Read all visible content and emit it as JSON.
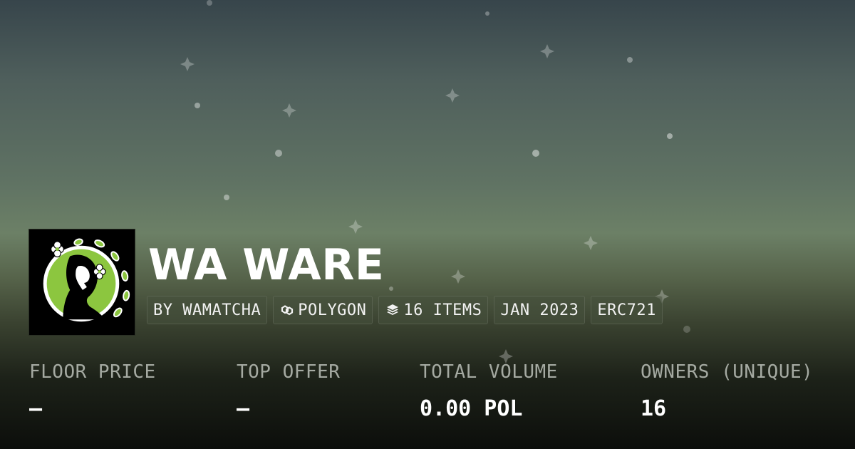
{
  "collection": {
    "name": "WA WARE",
    "creator": "BY WAMATCHA",
    "chain": "POLYGON",
    "items": "16 ITEMS",
    "created": "JAN 2023",
    "standard": "ERC721"
  },
  "icons": {
    "chain": "polygon-link-icon",
    "items": "layers-stack-icon"
  },
  "stats": [
    {
      "label": "FLOOR PRICE",
      "value": "—"
    },
    {
      "label": "TOP OFFER",
      "value": "—"
    },
    {
      "label": "TOTAL VOLUME",
      "value": "0.00 POL"
    },
    {
      "label": "OWNERS (UNIQUE)",
      "value": "16"
    }
  ],
  "colors": {
    "logo_green": "#8cc63f",
    "logo_dark": "#000000",
    "label_grey": "#a5aaa2"
  }
}
